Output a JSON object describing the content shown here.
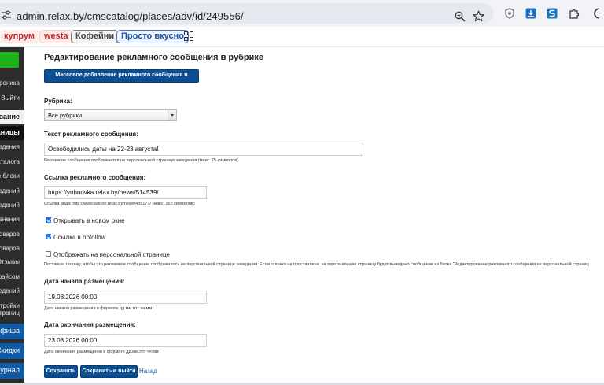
{
  "browser": {
    "url": "admin.relax.by/cmscatalog/places/adv/id/249556/",
    "bookmarks": [
      "купрум",
      "westa",
      "Кофейни",
      "Просто вкусно"
    ]
  },
  "sidebar": {
    "texts": [
      {
        "label": "роника"
      },
      {
        "label": "| Выйти"
      },
      {
        "label": "вание"
      },
      {
        "label": "аницы"
      },
      {
        "label": "едения"
      },
      {
        "label": "аталога"
      },
      {
        "label": "е блоки"
      },
      {
        "label": "едений"
      },
      {
        "label": "едений"
      },
      {
        "label": "енения"
      },
      {
        "label": "оваров"
      },
      {
        "label": "оваров"
      },
      {
        "label": "Отзывы"
      },
      {
        "label": "райсом"
      },
      {
        "label": "едений"
      },
      {
        "label": "стройки"
      },
      {
        "label": "траниц"
      },
      {
        "label": "афиша"
      },
      {
        "label": "Скидки"
      },
      {
        "label": "Журнал"
      }
    ]
  },
  "form": {
    "title": "Редактирование рекламного сообщения в рубрике",
    "mass_add_button": "Массовое добавление рекламного сообщения в рубрики",
    "rubric_label": "Рубрика:",
    "rubric_value": "Все рубрики",
    "message_label": "Текст рекламного сообщения:",
    "message_value": "Освободились даты на 22-23 августа!",
    "message_hint": "Рекламное сообщение отображается на персональной странице заведения (макс. 75 символов)",
    "link_label": "Ссылка рекламного сообщения:",
    "link_value": "https://yuhnovka.relax.by/news/514539/",
    "link_hint": "Ссылка вида: http://www.saloon.relax.by/news/435177/ (макс. 255 символов)",
    "new_window_label": "Открывать в новом окне",
    "nofollow_label": "Ссылка в nofollow",
    "personal_label": "Отображать на персональной странице",
    "personal_hint": "Поставьте галочку, чтобы это рекламное сообщение отображалось на персональной странице заведения. Если галочка не проставлена, на персональную страницу будет выведено сообщение из блока \"Редактирование рекламного сообщения на персональной страниц",
    "start_label": "Дата начала размещения:",
    "start_value": "19.08.2026 00:00",
    "start_hint": "Дата начала размещения в формате дд.мм.гггг чч:мм",
    "end_label": "Дата окончания размещения:",
    "end_value": "23.08.2026 00:00",
    "end_hint": "Дата окончания размещения в формате дд.мм.гггг чч:мм",
    "save_button": "Сохранить",
    "save_exit_button": "Сохранить и выйти",
    "back_link": "Назад"
  }
}
